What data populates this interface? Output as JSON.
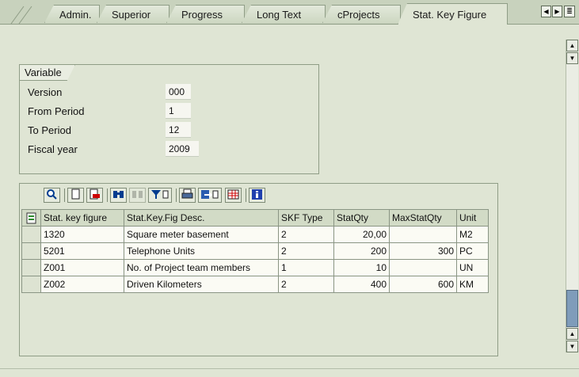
{
  "tabs": [
    {
      "label": "Admin.",
      "active": false
    },
    {
      "label": "Superior",
      "active": false
    },
    {
      "label": "Progress",
      "active": false
    },
    {
      "label": "Long Text",
      "active": false
    },
    {
      "label": "cProjects",
      "active": false
    },
    {
      "label": "Stat. Key Figure",
      "active": true
    }
  ],
  "variable": {
    "title": "Variable",
    "fields": [
      {
        "label": "Version",
        "value": "000"
      },
      {
        "label": "From Period",
        "value": "1"
      },
      {
        "label": "To Period",
        "value": "12"
      },
      {
        "label": "Fiscal year",
        "value": "2009"
      }
    ]
  },
  "grid": {
    "columns": [
      "Stat. key figure",
      "Stat.Key.Fig Desc.",
      "SKF Type",
      "StatQty",
      "MaxStatQty",
      "Unit"
    ],
    "rows": [
      {
        "key": "1320",
        "desc": "Square meter basement",
        "type": "2",
        "qty": "20,00",
        "max": "",
        "unit": "M2"
      },
      {
        "key": "5201",
        "desc": "Telephone Units",
        "type": "2",
        "qty": "200",
        "max": "300",
        "unit": "PC"
      },
      {
        "key": "Z001",
        "desc": "No. of Project team members",
        "type": "1",
        "qty": "10",
        "max": "",
        "unit": "UN"
      },
      {
        "key": "Z002",
        "desc": "Driven Kilometers",
        "type": "2",
        "qty": "400",
        "max": "600",
        "unit": "KM"
      }
    ]
  },
  "icons": {
    "toolbar": [
      "details-icon",
      "create-icon",
      "delete-icon",
      "find-icon",
      "find-next-icon",
      "filter-icon",
      "print-icon",
      "export-icon",
      "layout-grid-icon",
      "info-icon"
    ]
  }
}
